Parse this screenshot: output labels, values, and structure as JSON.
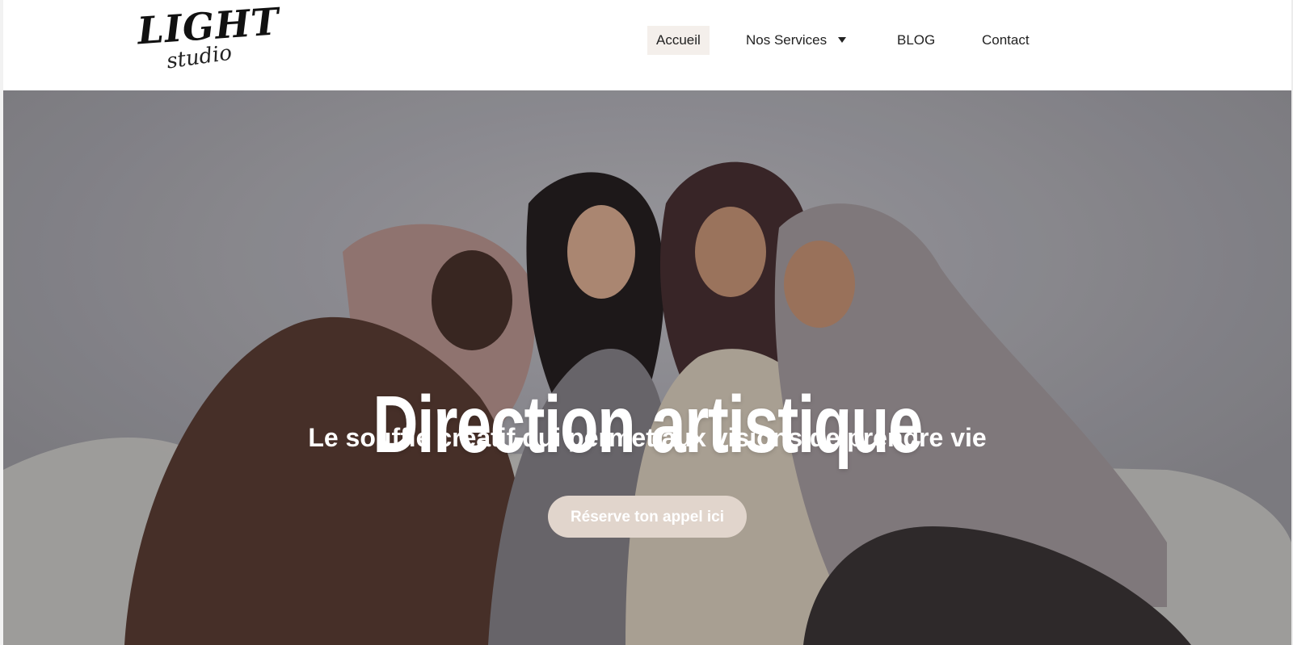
{
  "brand": {
    "logo_word": "LIGHT",
    "logo_script": "studio"
  },
  "nav": {
    "items": [
      {
        "label": "Accueil",
        "active": true
      },
      {
        "label": "Nos Services",
        "has_dropdown": true
      },
      {
        "label": "BLOG"
      },
      {
        "label": "Contact"
      }
    ]
  },
  "hero": {
    "title": "Direction artistique",
    "subtitle": "Le souffle créatif qui permet aux visions de prendre vie",
    "cta_label": "Réserve ton appel ici"
  },
  "colors": {
    "active_nav_bg": "#f4efeb",
    "cta_bg": "#e1d5cc",
    "hero_bg": "#8d8c92",
    "text_dark": "#222222"
  }
}
